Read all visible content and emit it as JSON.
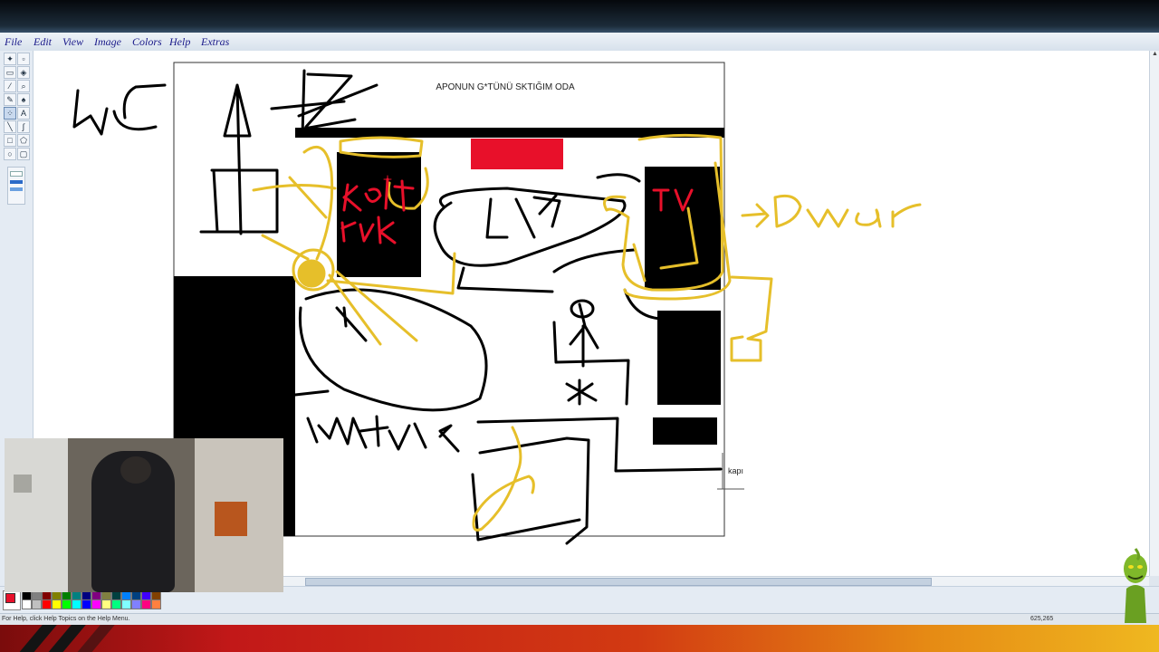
{
  "menu": {
    "items": [
      {
        "name": "menu-file",
        "label": "File"
      },
      {
        "name": "menu-edit",
        "label": "Edit"
      },
      {
        "name": "menu-view",
        "label": "View"
      },
      {
        "name": "menu-image",
        "label": "Image"
      },
      {
        "name": "menu-colors",
        "label": "Colors"
      },
      {
        "name": "menu-help",
        "label": "Help"
      },
      {
        "name": "menu-extras",
        "label": "Extras"
      }
    ]
  },
  "tools": [
    "free-select",
    "rect-select",
    "eraser",
    "fill",
    "color-picker",
    "magnifier",
    "pencil",
    "brush",
    "airbrush",
    "text",
    "line",
    "curve",
    "rectangle",
    "polygon",
    "ellipse",
    "rounded-rectangle"
  ],
  "drawing": {
    "title": "APONUN G*TÜNÜ SKTIĞIM ODA",
    "door_label": "kapı"
  },
  "palette": {
    "foreground": "#e8102a",
    "background": "#ffffff",
    "colors": [
      "#000000",
      "#808080",
      "#800000",
      "#808000",
      "#008000",
      "#008080",
      "#000080",
      "#800080",
      "#808040",
      "#004040",
      "#0080ff",
      "#004080",
      "#4000ff",
      "#804000",
      "#ffffff",
      "#c0c0c0",
      "#ff0000",
      "#ffff00",
      "#00ff00",
      "#00ffff",
      "#0000ff",
      "#ff00ff",
      "#ffff80",
      "#00ff80",
      "#80ffff",
      "#8080ff",
      "#ff0080",
      "#ff8040"
    ]
  },
  "status": {
    "help_text": "For Help, click Help Topics on the Help Menu.",
    "coords": "625,265"
  },
  "colors": {
    "ink_black": "#000000",
    "ink_yellow": "#e6bf2a",
    "ink_red": "#e8102a",
    "menu_text": "#1a1a8a"
  }
}
